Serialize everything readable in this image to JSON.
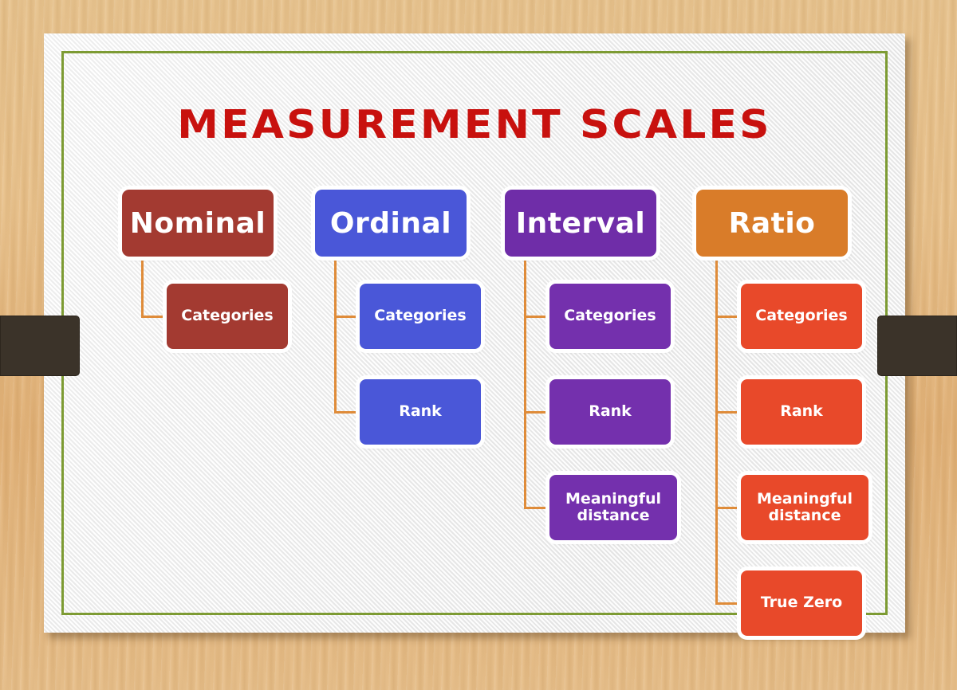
{
  "title": "MEASUREMENT SCALES",
  "theme": {
    "title_color": "#c8110e",
    "connector_color": "#df8c3a",
    "frame_border_color": "#7d9b33",
    "slide_background": "#f4f4f4",
    "page_background": "#e3b97f",
    "clip_tab_color": "#3b3329"
  },
  "chart_data": {
    "type": "diagram",
    "title": "MEASUREMENT SCALES",
    "layout": "four-column hierarchy tree",
    "columns": [
      {
        "label": "Nominal",
        "color": "#a33a31",
        "child_color": "#a33a31",
        "children": [
          "Categories"
        ]
      },
      {
        "label": "Ordinal",
        "color": "#4a57d8",
        "child_color": "#4a57d8",
        "children": [
          "Categories",
          "Rank"
        ]
      },
      {
        "label": "Interval",
        "color": "#6f2da8",
        "child_color": "#7430ad",
        "children": [
          "Categories",
          "Rank",
          "Meaningful distance"
        ]
      },
      {
        "label": "Ratio",
        "color": "#d97c29",
        "child_color": "#e8492a",
        "children": [
          "Categories",
          "Rank",
          "Meaningful distance",
          "True Zero"
        ]
      }
    ]
  },
  "clip_tabs": {
    "left_label": "",
    "right_label": ""
  }
}
